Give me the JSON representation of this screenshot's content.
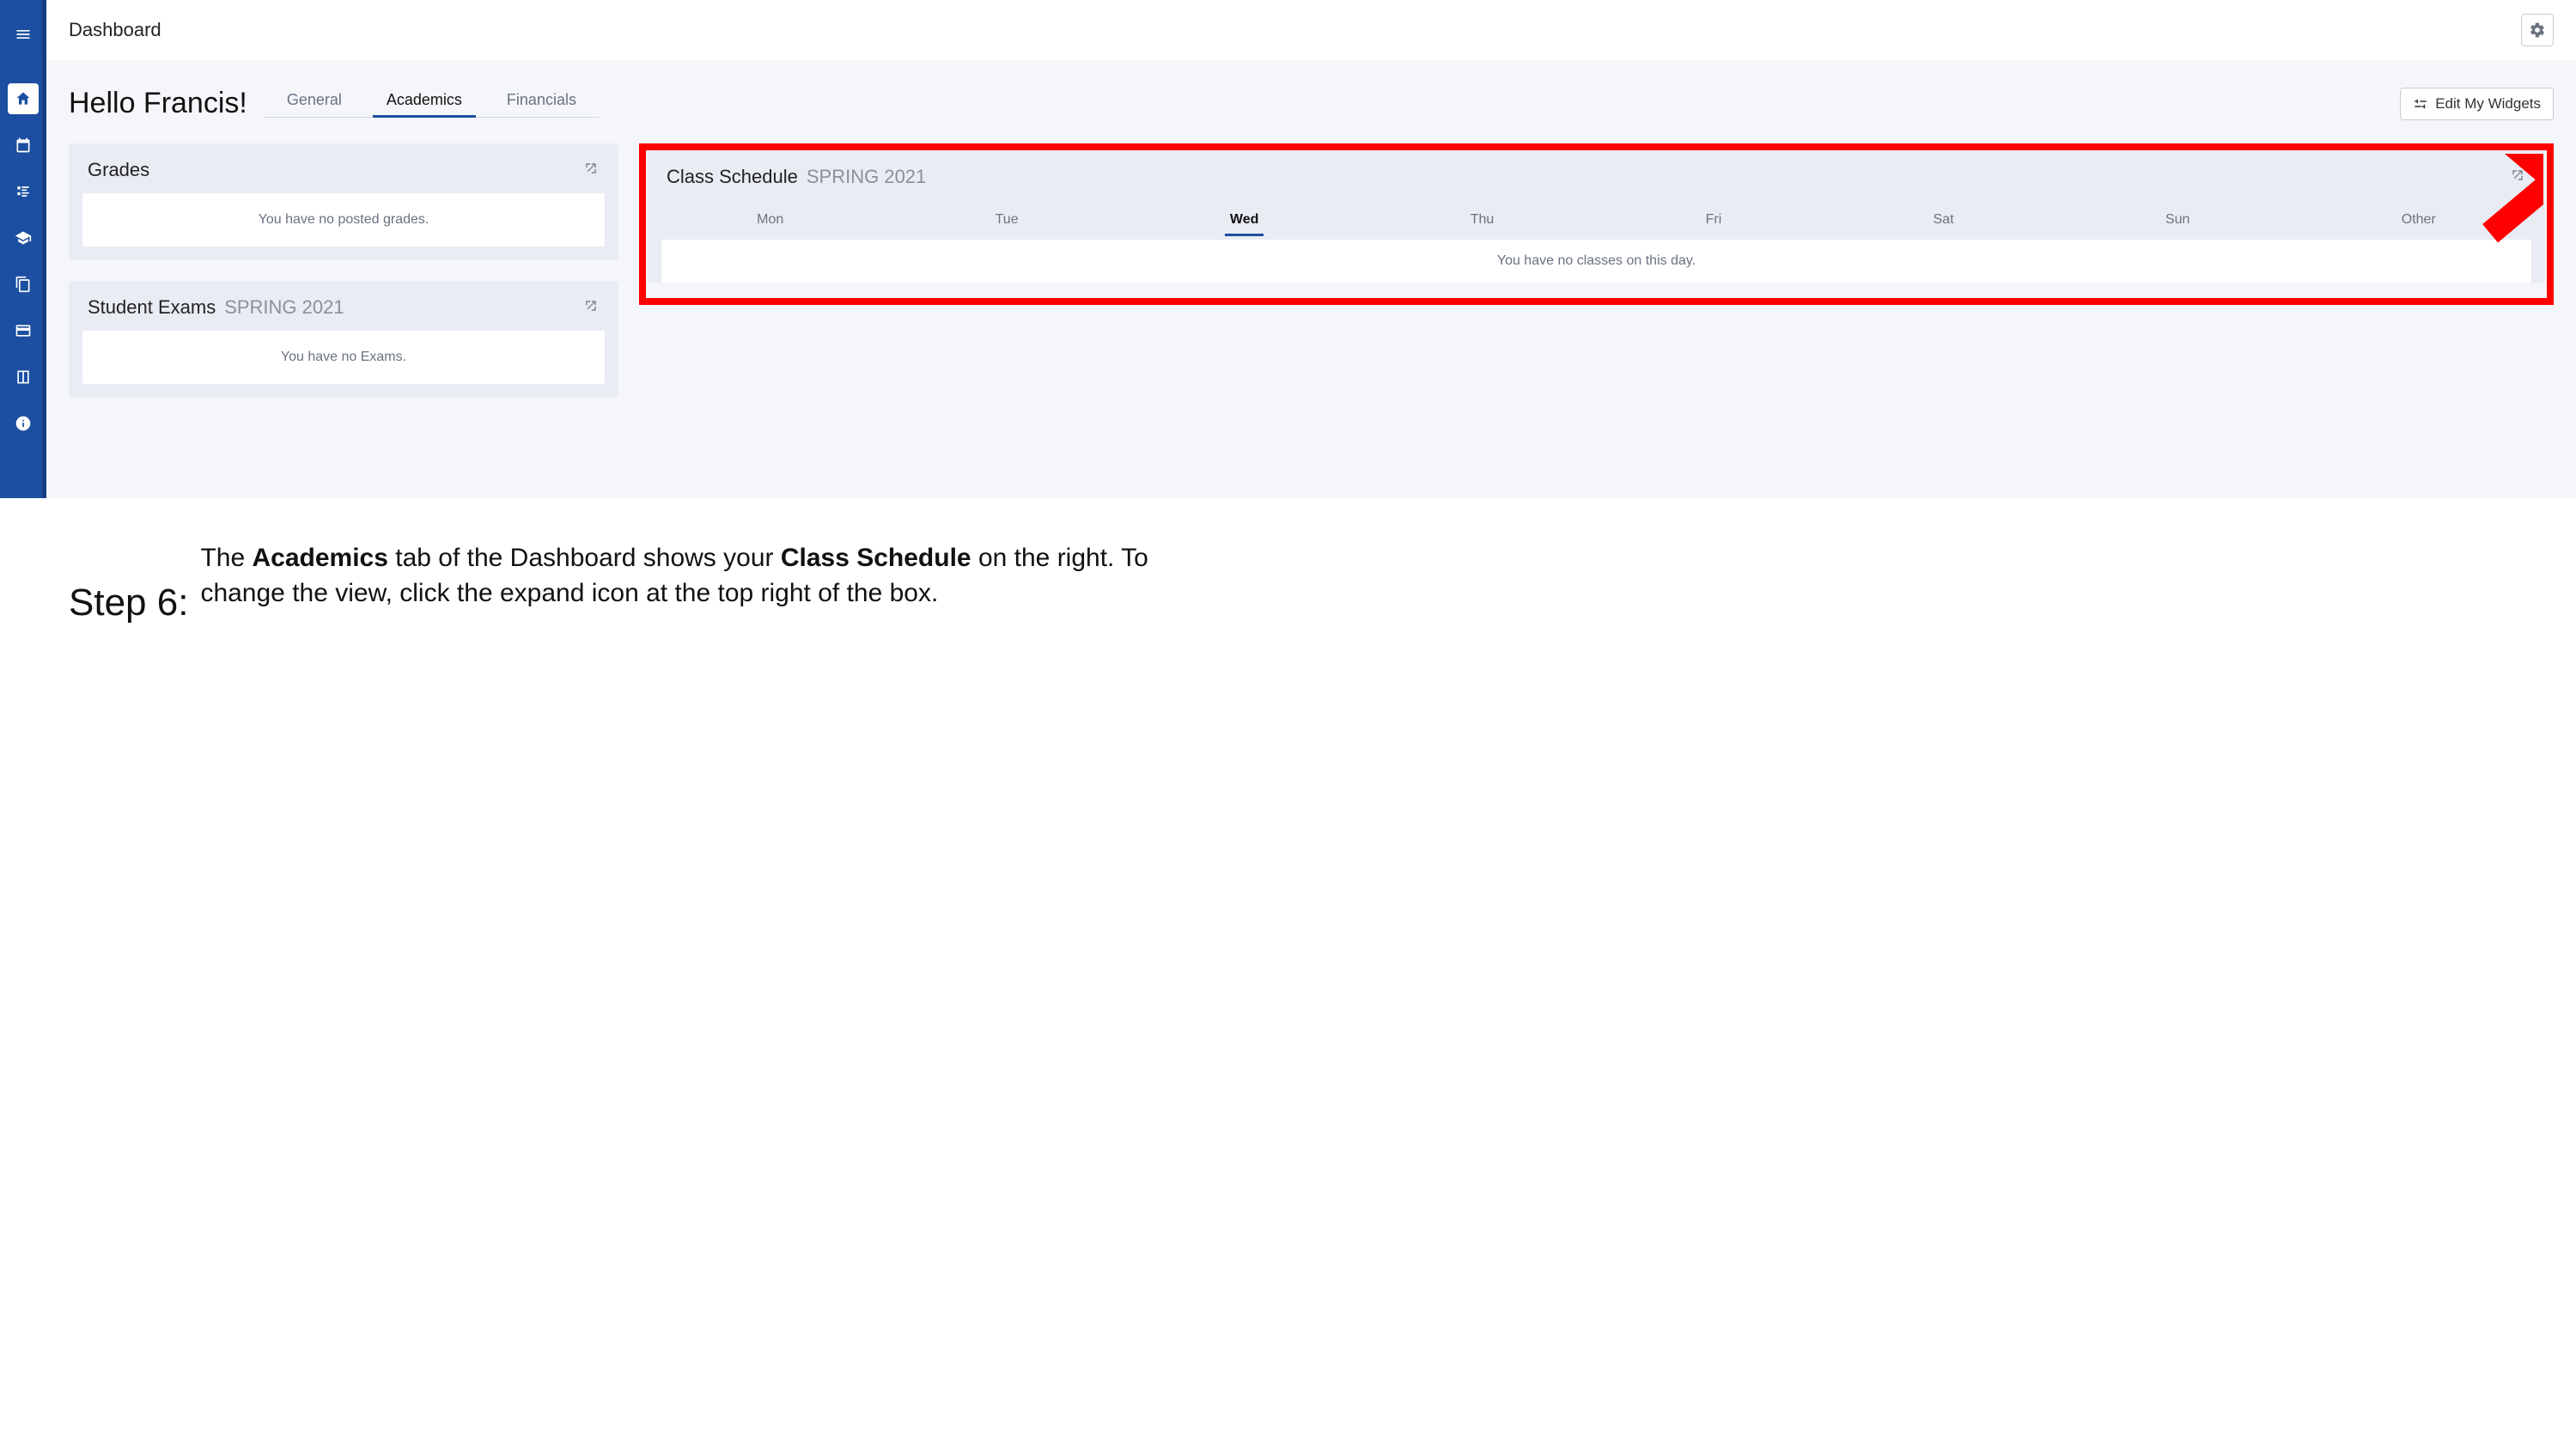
{
  "topbar": {
    "title": "Dashboard"
  },
  "greeting": "Hello Francis!",
  "tabs": {
    "general": "General",
    "academics": "Academics",
    "financials": "Financials",
    "active": "academics"
  },
  "edit_widgets_label": "Edit My Widgets",
  "widgets": {
    "grades": {
      "title": "Grades",
      "empty": "You have no posted grades."
    },
    "exams": {
      "title": "Student Exams",
      "term": "SPRING 2021",
      "empty": "You have no Exams."
    },
    "schedule": {
      "title": "Class Schedule",
      "term": "SPRING 2021",
      "days": [
        "Mon",
        "Tue",
        "Wed",
        "Thu",
        "Fri",
        "Sat",
        "Sun",
        "Other"
      ],
      "active_day": "Wed",
      "empty": "You have no classes on this day."
    }
  },
  "instruction": {
    "step": "Step 6:",
    "text_parts": [
      "The ",
      "Academics",
      " tab of the Dashboard shows your ",
      "Class Schedule",
      " on the right.  To change the view, click the expand icon at the top right of the box."
    ]
  }
}
